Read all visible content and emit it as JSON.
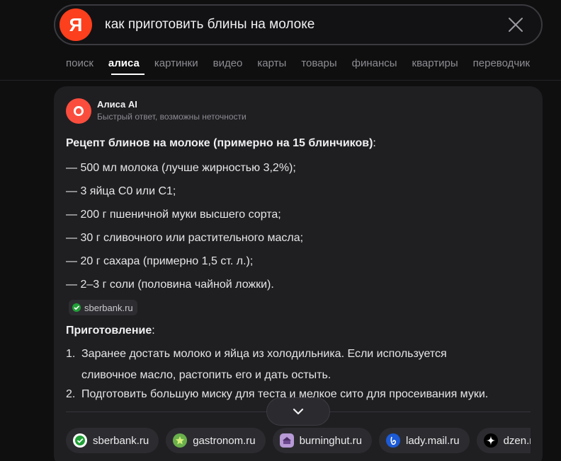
{
  "search": {
    "logo_letter": "Я",
    "query": "как приготовить блины на молоке"
  },
  "tabs": [
    "поиск",
    "алиса",
    "картинки",
    "видео",
    "карты",
    "товары",
    "финансы",
    "квартиры",
    "переводчик"
  ],
  "answer": {
    "author": "Алиса AI",
    "disclaimer": "Быстрый ответ, возможны неточности",
    "recipe_heading": "Рецепт блинов на молоке (примерно на 15 блинчиков)",
    "recipe_heading_colon": ":",
    "ingredients": [
      "— 500 мл молока (лучше жирностью 3,2%);",
      "— 3 яйца С0 или С1;",
      "— 200 г пшеничной муки высшего сорта;",
      "— 30 г сливочного или растительного масла;",
      "— 20 г сахара (примерно 1,5 ст. л.);",
      "— 2–3 г соли (половина чайной ложки)."
    ],
    "inline_source": "sberbank.ru",
    "prep_heading": "Приготовление",
    "prep_heading_colon": ":",
    "steps": [
      {
        "n": "1.",
        "line1": "Заранее достать молоко и яйца из холодильника. Если используется",
        "line2": "сливочное масло, растопить его и дать остыть."
      },
      {
        "n": "2.",
        "line1": "Подготовить большую миску для теста и мелкое сито для просеивания муки.",
        "line2": ""
      }
    ]
  },
  "sources": [
    "sberbank.ru",
    "gastronom.ru",
    "burninghut.ru",
    "lady.mail.ru",
    "dzen.ru"
  ],
  "colors": {
    "yandex_red": "#fc3f1d",
    "alice_red": "#fb4d3d",
    "background": "#0f0f10",
    "card": "#1f1f22"
  }
}
